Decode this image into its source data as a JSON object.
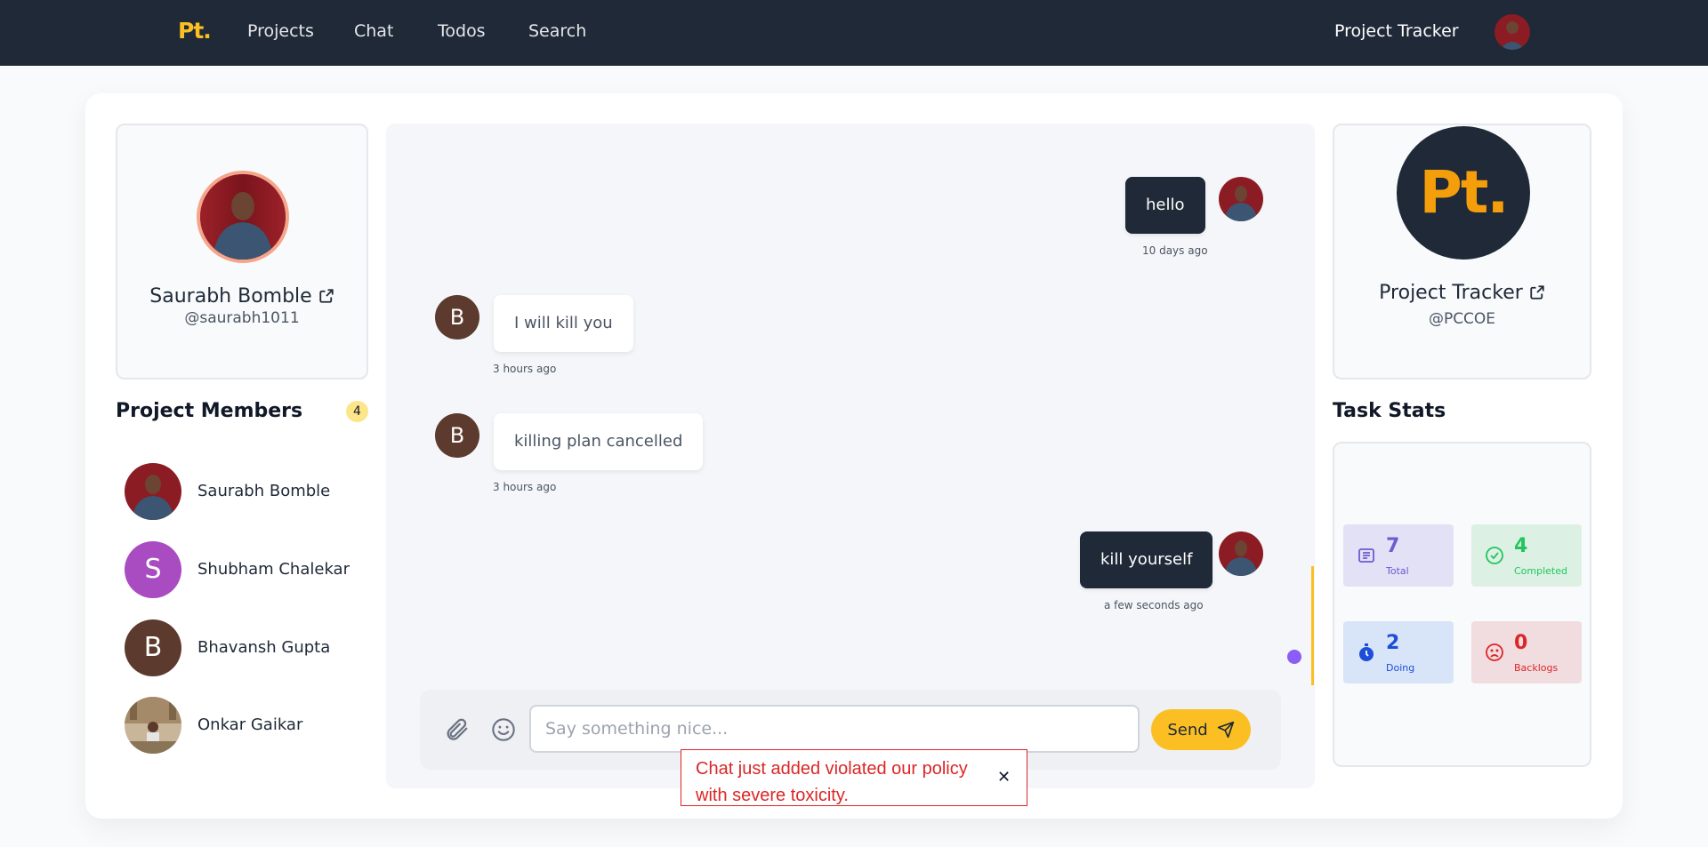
{
  "nav": {
    "logo": "Pt.",
    "links": [
      "Projects",
      "Chat",
      "Todos",
      "Search"
    ],
    "title": "Project Tracker"
  },
  "profile": {
    "name": "Saurabh Bomble",
    "handle": "@saurabh1011"
  },
  "members": {
    "heading": "Project Members",
    "count": "4",
    "items": [
      {
        "name": "Saurabh Bomble",
        "initial": "",
        "color": "#8b1c24"
      },
      {
        "name": "Shubham Chalekar",
        "initial": "S",
        "color": "#a94bc1"
      },
      {
        "name": "Bhavansh Gupta",
        "initial": "B",
        "color": "#5c3b2e"
      },
      {
        "name": "Onkar Gaikar",
        "initial": "",
        "color": "#b8a082"
      }
    ]
  },
  "chat": {
    "messages": [
      {
        "text": "hello",
        "time": "10 days ago",
        "own": true
      },
      {
        "text": "I will kill you",
        "time": "3 hours ago",
        "own": false,
        "initial": "B"
      },
      {
        "text": "killing plan cancelled",
        "time": "3 hours ago",
        "own": false,
        "initial": "B"
      },
      {
        "text": "kill yourself",
        "time": "a few seconds ago",
        "own": true
      }
    ],
    "input_placeholder": "Say something nice...",
    "send_label": "Send"
  },
  "toast": {
    "message": "Chat just added violated our policy with severe toxicity.",
    "close": "✕"
  },
  "project": {
    "logo": "Pt.",
    "name": "Project Tracker",
    "handle": "@PCCOE"
  },
  "stats": {
    "heading": "Task Stats",
    "items": [
      {
        "value": "7",
        "label": "Total",
        "color": "#6d5bd0",
        "bg": "#e3e1f6"
      },
      {
        "value": "4",
        "label": "Completed",
        "color": "#22c55e",
        "bg": "#dcf1e4"
      },
      {
        "value": "2",
        "label": "Doing",
        "color": "#1d4ed8",
        "bg": "#d8e4f8"
      },
      {
        "value": "0",
        "label": "Backlogs",
        "color": "#dc2626",
        "bg": "#f1dde0"
      }
    ]
  }
}
